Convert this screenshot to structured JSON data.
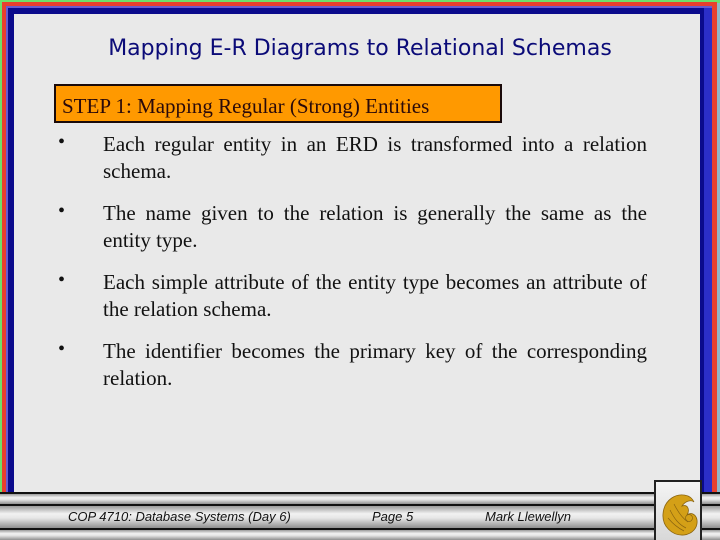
{
  "slide": {
    "title": "Mapping E-R Diagrams to Relational Schemas",
    "step_banner": "STEP 1:  Mapping Regular (Strong) Entities",
    "bullets": [
      {
        "marker": "•",
        "text": "Each regular entity in an ERD is transformed into a relation schema."
      },
      {
        "marker": "•",
        "text": "The name given to the relation is generally the same as the entity type."
      },
      {
        "marker": "•",
        "text": "Each simple attribute of the entity type becomes an attribute of the relation schema."
      },
      {
        "marker": "•",
        "text": "The identifier becomes the primary key of the corresponding relation."
      }
    ]
  },
  "footer": {
    "course": "COP 4710: Database Systems  (Day 6)",
    "page": "Page 5",
    "author": "Mark Llewellyn",
    "logo_icon": "pegasus-logo-icon"
  },
  "colors": {
    "title": "#0b0b78",
    "banner": "#ff9900",
    "border_green": "#6fe06a",
    "border_red": "#e8402e",
    "border_navy": "#0a0a8c",
    "logo_gold": "#d4a017"
  }
}
